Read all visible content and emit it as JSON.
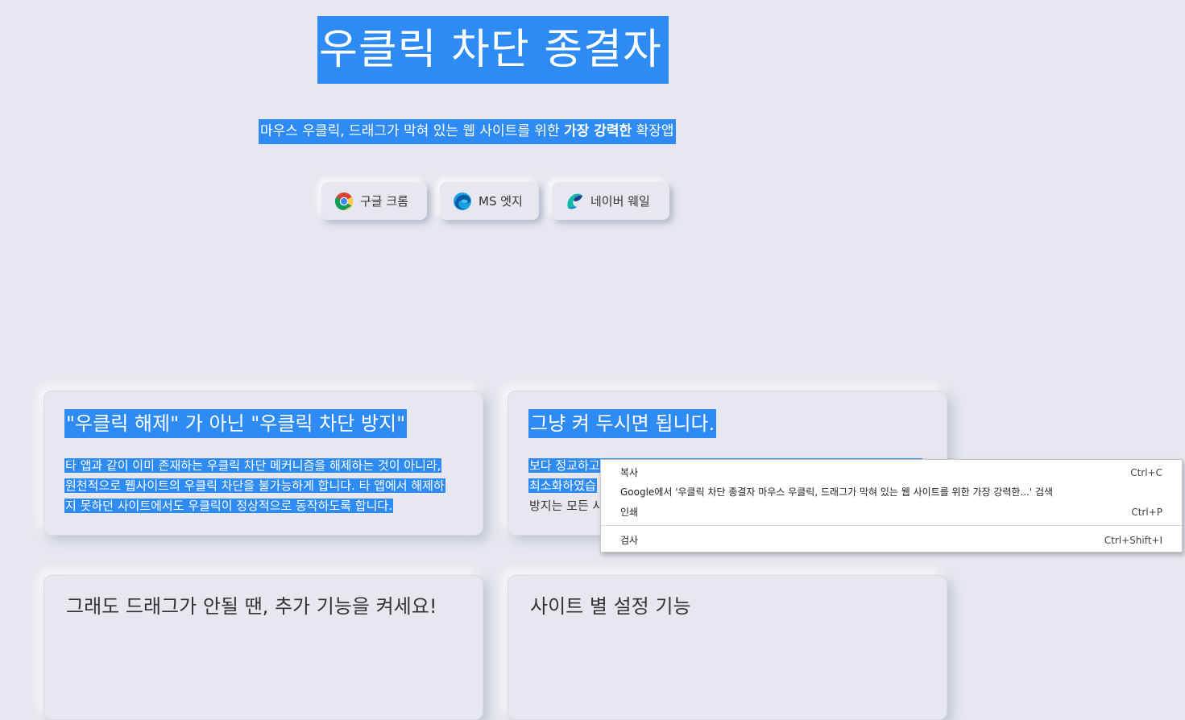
{
  "hero": {
    "title": "우클릭 차단 종결자",
    "subtitle_pre": "마우스 우클릭, 드래그가 막혀 있는 웹 사이트를 위한 ",
    "subtitle_bold": "가장 강력한",
    "subtitle_post": " 확장앱"
  },
  "browsers": [
    {
      "label": "구글 크롬",
      "icon": "chrome-icon"
    },
    {
      "label": "MS 엣지",
      "icon": "edge-icon"
    },
    {
      "label": "네이버 웨일",
      "icon": "whale-icon"
    }
  ],
  "cards": [
    {
      "title": "\"우클릭 해제\" 가 아닌 \"우클릭 차단 방지\"",
      "lines": [
        "타 앱과 같이 이미 존재하는 우클릭 차단 메커니즘을 해제하는 것이 아니라,",
        "원천적으로 웹사이트의 우클릭 차단을 불가능하게 합니다. 타 앱에서 해제하",
        "지 못하던 사이트에서도 우클릭이 정상적으로 동작하도록 합니다."
      ]
    },
    {
      "title": "그냥 켜 두시면 됩니다.",
      "lines": [
        "보다 정교하고",
        "최소화하였습",
        "방지는 모든 사"
      ]
    },
    {
      "title": "그래도 드래그가 안될 땐, 추가 기능을 켜세요!",
      "lines": []
    },
    {
      "title": "사이트 별 설정 기능",
      "lines": []
    }
  ],
  "context_menu": {
    "items": [
      {
        "label": "복사",
        "shortcut": "Ctrl+C"
      },
      {
        "label": "Google에서 '우클릭 차단 종결자 마우스 우클릭, 드래그가 막혀 있는 웹 사이트를 위한 가장 강력한...' 검색",
        "shortcut": ""
      },
      {
        "label": "인쇄",
        "shortcut": "Ctrl+P"
      },
      {
        "label": "검사",
        "shortcut": "Ctrl+Shift+I"
      }
    ]
  },
  "colors": {
    "background": "#e6e7ef",
    "selection": "#2e8bf4",
    "text": "#333333"
  }
}
